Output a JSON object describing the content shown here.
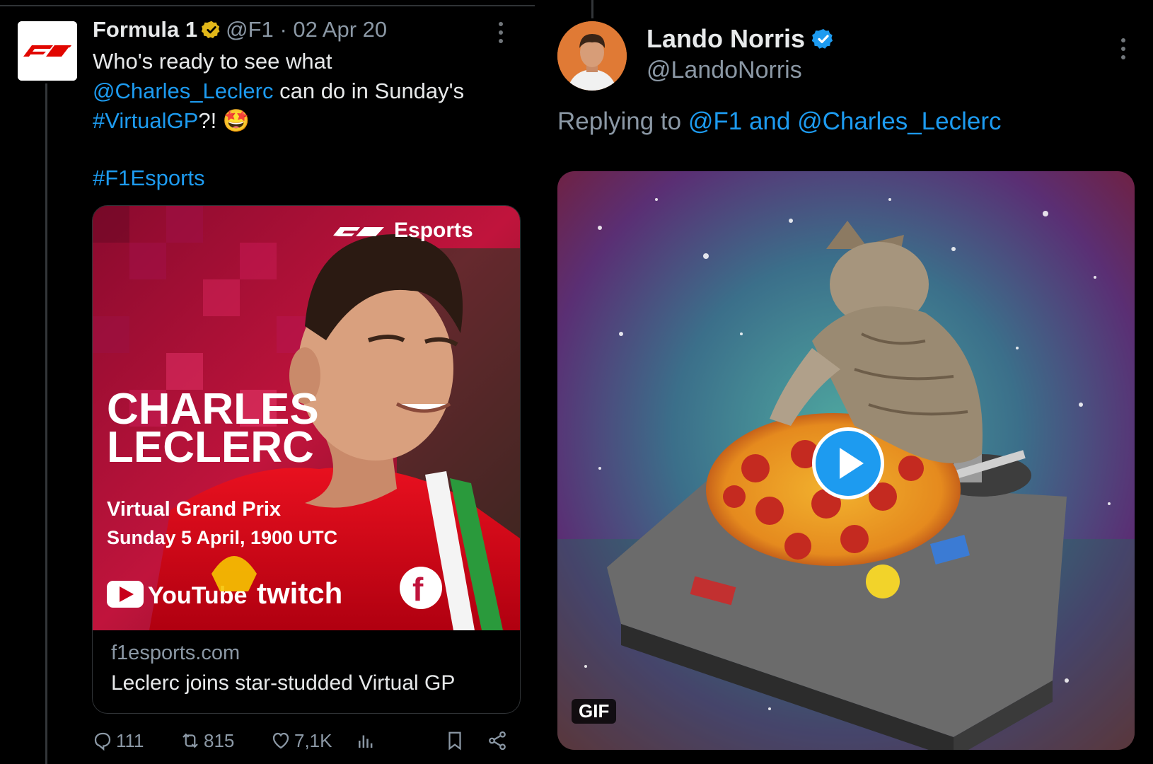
{
  "left_tweet": {
    "author_name": "Formula 1",
    "handle": "@F1",
    "separator": "·",
    "date": "02 Apr 20",
    "text_part1": "Who's ready to see what",
    "mention": "@Charles_Leclerc",
    "text_part2": "can do in Sunday's",
    "hashtag_virtualgp": "#VirtualGP",
    "text_part3": "?!",
    "emoji": "🤩",
    "hashtag_f1esports": "#F1Esports",
    "card": {
      "image": {
        "esports_label": "Esports",
        "name_line1": "CHARLES",
        "name_line2": "LECLERC",
        "event": "Virtual Grand Prix",
        "datetime": "Sunday 5 April, 1900 UTC",
        "youtube": "YouTube",
        "twitch": "twitch",
        "facebook": "f"
      },
      "domain": "f1esports.com",
      "title": "Leclerc joins star-studded Virtual GP"
    },
    "actions": {
      "replies": "111",
      "retweets": "815",
      "likes": "7,1K"
    }
  },
  "right_tweet": {
    "author_name": "Lando Norris",
    "handle": "@LandoNorris",
    "replying_prefix": "Replying to",
    "replying_to": "@F1 and @Charles_Leclerc",
    "media_badge": "GIF"
  },
  "colors": {
    "accent": "#1d9bf0",
    "muted": "#8b98a5",
    "text": "#e7e9ea",
    "background": "#000000",
    "f1_red": "#e10600",
    "gold_badge": "#e2b719"
  },
  "icons": {
    "verified_gold": "verified-gold-icon",
    "verified_blue": "verified-blue-icon",
    "more": "more-vertical-icon",
    "reply": "reply-icon",
    "retweet": "retweet-icon",
    "like": "heart-icon",
    "views": "views-icon",
    "bookmark": "bookmark-icon",
    "share": "share-icon",
    "play": "play-icon"
  }
}
